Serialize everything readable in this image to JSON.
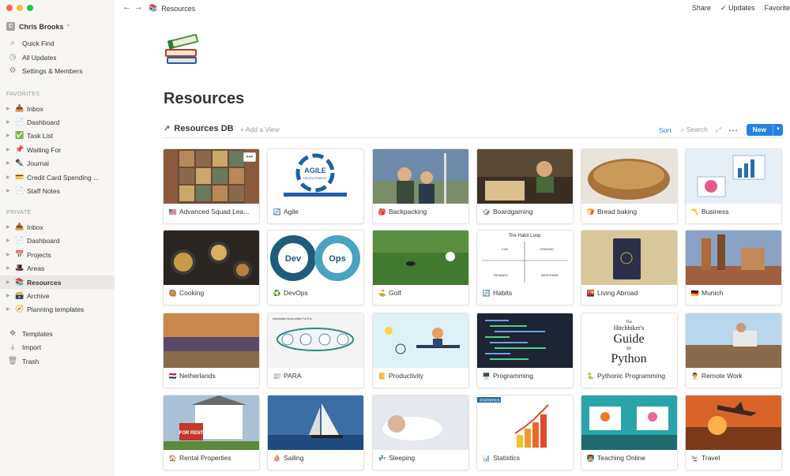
{
  "workspace": {
    "avatar": "C",
    "name": "Chris Brooks"
  },
  "sidebar": {
    "top": [
      {
        "icon": "search-icon",
        "glyph": "⌕",
        "label": "Quick Find"
      },
      {
        "icon": "clock-icon",
        "glyph": "◷",
        "label": "All Updates"
      },
      {
        "icon": "gear-icon",
        "glyph": "⚙",
        "label": "Settings & Members"
      }
    ],
    "favorites_label": "FAVORITES",
    "favorites": [
      {
        "glyph": "📥",
        "label": "Inbox"
      },
      {
        "glyph": "📄",
        "label": "Dashboard"
      },
      {
        "glyph": "✅",
        "label": "Task List"
      },
      {
        "glyph": "📌",
        "label": "Waiting For"
      },
      {
        "glyph": "✒️",
        "label": "Journal"
      },
      {
        "glyph": "💳",
        "label": "Credit Card Spending ..."
      },
      {
        "glyph": "📄",
        "label": "Staff Notes"
      }
    ],
    "private_label": "PRIVATE",
    "private": [
      {
        "glyph": "📥",
        "label": "Inbox"
      },
      {
        "glyph": "📄",
        "label": "Dashboard"
      },
      {
        "glyph": "📅",
        "label": "Projects"
      },
      {
        "glyph": "🎩",
        "label": "Areas"
      },
      {
        "glyph": "📚",
        "label": "Resources"
      },
      {
        "glyph": "🗃️",
        "label": "Archive"
      },
      {
        "glyph": "🧭",
        "label": "Planning templates"
      }
    ],
    "bottom": [
      {
        "icon": "templates-icon",
        "glyph": "❖",
        "label": "Templates"
      },
      {
        "icon": "import-icon",
        "glyph": "⤓",
        "label": "Import"
      },
      {
        "icon": "trash-icon",
        "glyph": "🗑",
        "label": "Trash"
      }
    ]
  },
  "topbar": {
    "back": "←",
    "forward": "→",
    "crumb_icon": "📚",
    "crumb": "Resources",
    "share": "Share",
    "updates": "✓ Updates",
    "favorite": "Favorite"
  },
  "page": {
    "icon": "books-icon",
    "title": "Resources"
  },
  "db": {
    "title": "Resources DB",
    "add_view": "+ Add a View",
    "sort": "Sort",
    "search": "⌕ Search",
    "expand": "⤢",
    "more": "•••",
    "new": "New",
    "new_caret": "▼"
  },
  "cards": [
    {
      "name": "Advanced Squad Lea...",
      "icon": "🇺🇸",
      "bg": "#8b5a3c",
      "accent": "#c9a86a"
    },
    {
      "name": "Agile",
      "icon": "🔄",
      "bg": "#ffffff",
      "accent": "#1f5fa8"
    },
    {
      "name": "Backpacking",
      "icon": "🎒",
      "bg": "#6e8aa8",
      "accent": "#3b4a3a"
    },
    {
      "name": "Boardgaming",
      "icon": "🎲",
      "bg": "#5a4a35",
      "accent": "#d9c08c"
    },
    {
      "name": "Bread baking",
      "icon": "🍞",
      "bg": "#e8e4dc",
      "accent": "#a8733a"
    },
    {
      "name": "Business",
      "icon": "〽️",
      "bg": "#e6eef6",
      "accent": "#2b6cb0"
    },
    {
      "name": "Cooking",
      "icon": "🥘",
      "bg": "#2a2520",
      "accent": "#c99a45"
    },
    {
      "name": "DevOps",
      "icon": "♻️",
      "bg": "#ffffff",
      "accent": "#1e5c7a"
    },
    {
      "name": "Golf",
      "icon": "⛳",
      "bg": "#3f7a2f",
      "accent": "#ffffff"
    },
    {
      "name": "Habits",
      "icon": "🔄",
      "bg": "#ffffff",
      "accent": "#555555"
    },
    {
      "name": "Living Abroad",
      "icon": "🌇",
      "bg": "#d7c79a",
      "accent": "#2b2f4a"
    },
    {
      "name": "Munich",
      "icon": "🇩🇪",
      "bg": "#8aa3c4",
      "accent": "#b06a3a"
    },
    {
      "name": "Netherlands",
      "icon": "🇳🇱",
      "bg": "#d39a5a",
      "accent": "#5a4a6a"
    },
    {
      "name": "PARA",
      "icon": "📰",
      "bg": "#f4f4f4",
      "accent": "#2e8b7a"
    },
    {
      "name": "Productivity",
      "icon": "📒",
      "bg": "#dff1f7",
      "accent": "#2a3a55"
    },
    {
      "name": "Programming",
      "icon": "🖥️",
      "bg": "#1d2433",
      "accent": "#4fd18b"
    },
    {
      "name": "Pythonic Programming",
      "icon": "🐍",
      "bg": "#ffffff",
      "accent": "#222222"
    },
    {
      "name": "Remote Work",
      "icon": "👨‍💼",
      "bg": "#b9d7ea",
      "accent": "#8a6a4a"
    },
    {
      "name": "Rental Properties",
      "icon": "🏠",
      "bg": "#a9c0d6",
      "accent": "#c0392b"
    },
    {
      "name": "Sailing",
      "icon": "⛵",
      "bg": "#3b6ea5",
      "accent": "#f2f2f2"
    },
    {
      "name": "Sleeping",
      "icon": "💤",
      "bg": "#e6e8ef",
      "accent": "#d9b59a"
    },
    {
      "name": "Statistics",
      "icon": "📊",
      "bg": "#ffffff",
      "accent": "#e04a2a"
    },
    {
      "name": "Teaching Online",
      "icon": "👨‍🏫",
      "bg": "#2aa4a9",
      "accent": "#e9792d"
    },
    {
      "name": "Travel",
      "icon": "🛬",
      "bg": "#d9642a",
      "accent": "#3a2a20"
    }
  ],
  "cover_labels": {
    "agile_text": "AGILE",
    "agile_sub": "DEVELOPMENT",
    "devops_left": "Dev",
    "devops_right": "Ops",
    "habit_title": "The Habit Loop",
    "habit_q1": "CUE",
    "habit_q2": "CRAVING",
    "habit_q3": "REWARD",
    "habit_q4": "RESPONSE",
    "para_title": "Information flows within P.A.R.A.",
    "python_line1": "The",
    "python_line2": "Hitchhiker's",
    "python_line3": "Guide",
    "python_line4": "to",
    "python_line5": "Python",
    "rent_sign": "FOR RENT",
    "stats_label": "STATISTICS",
    "card_more": "•••"
  }
}
